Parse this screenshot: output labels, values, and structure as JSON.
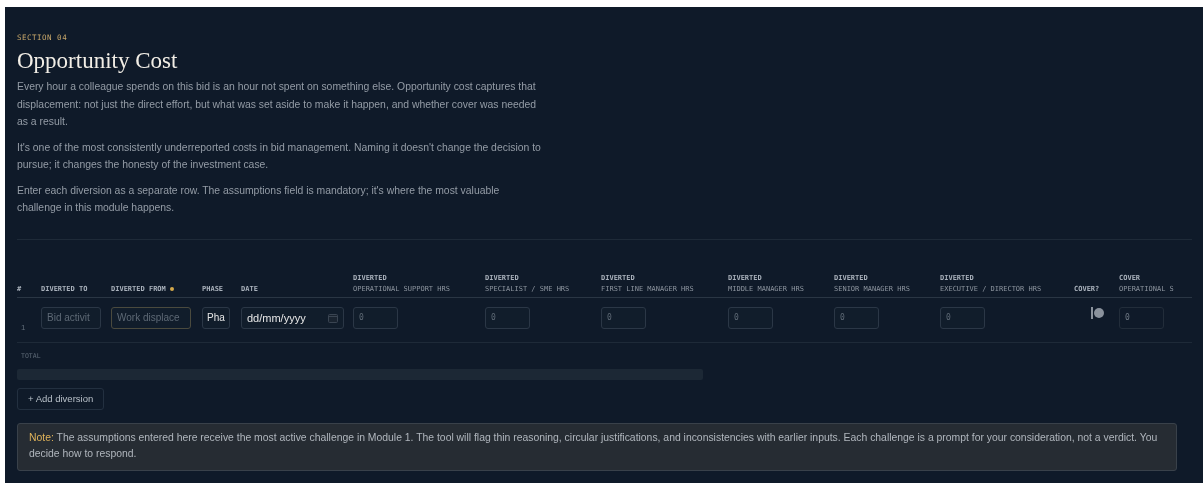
{
  "section_label": "SECTION 04",
  "title": "Opportunity Cost",
  "paragraphs": [
    "Every hour a colleague spends on this bid is an hour not spent on something else. Opportunity cost captures that displacement: not just the direct effort, but what was set aside to make it happen, and whether cover was needed as a result.",
    "It's one of the most consistently underreported costs in bid management. Naming it doesn't change the decision to pursue; it changes the honesty of the investment case.",
    "Enter each diversion as a separate row. The assumptions field is mandatory; it's where the most valuable challenge in this module happens."
  ],
  "table": {
    "columns": [
      {
        "label": "#",
        "required": false
      },
      {
        "label": "DIVERTED TO",
        "required": false
      },
      {
        "label": "DIVERTED FROM",
        "required": true
      },
      {
        "label": "PHASE",
        "required": false
      },
      {
        "label": "DATE",
        "required": false
      },
      {
        "label": "DIVERTED",
        "sublabel": "OPERATIONAL SUPPORT HRS",
        "required": false
      },
      {
        "label": "DIVERTED",
        "sublabel": "SPECIALIST / SME HRS",
        "required": false
      },
      {
        "label": "DIVERTED",
        "sublabel": "FIRST LINE MANAGER HRS",
        "required": false
      },
      {
        "label": "DIVERTED",
        "sublabel": "MIDDLE MANAGER HRS",
        "required": false
      },
      {
        "label": "DIVERTED",
        "sublabel": "SENIOR MANAGER HRS",
        "required": false
      },
      {
        "label": "DIVERTED",
        "sublabel": "EXECUTIVE / DIRECTOR HRS",
        "required": false
      },
      {
        "label": "COVER?",
        "required": false
      },
      {
        "label": "COVER",
        "sublabel": "OPERATIONAL S",
        "required": false
      }
    ],
    "rows": [
      {
        "cells": [
          {
            "kind": "index",
            "text": "1",
            "disabled": false
          },
          {
            "kind": "text",
            "placeholder": "Bid activit",
            "disabled": false
          },
          {
            "kind": "text",
            "placeholder": "Work displace",
            "disabled": false
          },
          {
            "kind": "select",
            "value": "Pha",
            "disabled": false
          },
          {
            "kind": "date",
            "value": "dd/mm/yyyy",
            "disabled": false
          },
          {
            "kind": "number",
            "placeholder": "0",
            "disabled": false
          },
          {
            "kind": "number",
            "placeholder": "0",
            "disabled": false
          },
          {
            "kind": "number",
            "placeholder": "0",
            "disabled": false
          },
          {
            "kind": "number",
            "placeholder": "0",
            "disabled": false
          },
          {
            "kind": "number",
            "placeholder": "0",
            "disabled": false
          },
          {
            "kind": "number",
            "placeholder": "0",
            "disabled": false
          },
          {
            "kind": "toggle",
            "on": false,
            "disabled": false
          },
          {
            "kind": "number",
            "placeholder": "0",
            "disabled": true
          }
        ]
      }
    ],
    "total_label": "TOTAL"
  },
  "add_button": "+ Add diversion",
  "note": {
    "label": "Note:",
    "text": "The assumptions entered here receive the most active challenge in Module 1. The tool will flag thin reasoning, circular justifications, and inconsistencies with earlier inputs. Each challenge is a prompt for your consideration, not a verdict. You decide how to respond."
  }
}
